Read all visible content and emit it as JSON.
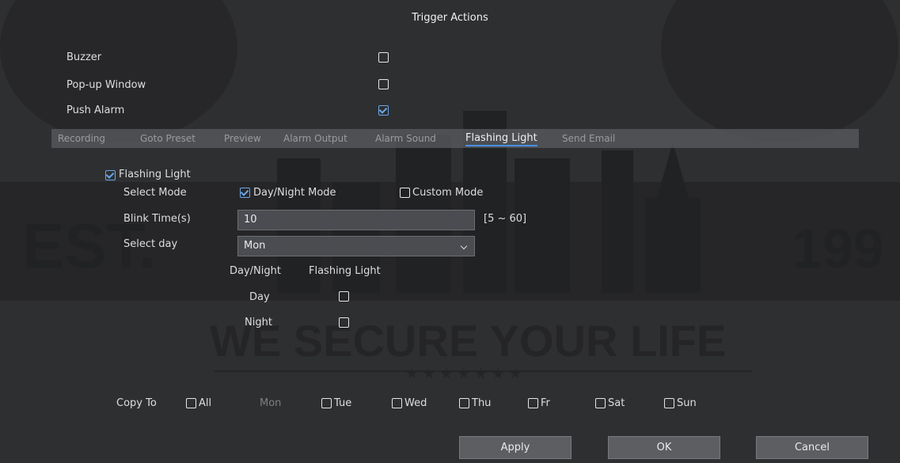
{
  "dialog": {
    "title": "Trigger Actions"
  },
  "options": [
    {
      "label": "Buzzer",
      "checked": false
    },
    {
      "label": "Pop-up Window",
      "checked": false
    },
    {
      "label": "Push Alarm",
      "checked": true
    }
  ],
  "tabs": [
    "Recording",
    "Goto Preset",
    "Preview",
    "Alarm Output",
    "Alarm Sound",
    "Flashing Light",
    "Send Email"
  ],
  "active_tab": "Flashing Light",
  "flashing": {
    "enable_label": "Flashing Light",
    "enable_checked": true,
    "select_mode_label": "Select Mode",
    "mode_daynight_label": "Day/Night Mode",
    "mode_daynight_checked": true,
    "mode_custom_label": "Custom Mode",
    "mode_custom_checked": false,
    "blink_label": "Blink Time(s)",
    "blink_value": "10",
    "blink_range": "[5 ~ 60]",
    "select_day_label": "Select day",
    "select_day_value": "Mon",
    "table_col1": "Day/Night",
    "table_col2": "Flashing Light",
    "rows": [
      {
        "label": "Day",
        "checked": false
      },
      {
        "label": "Night",
        "checked": false
      }
    ]
  },
  "copy": {
    "label": "Copy To",
    "all": "All",
    "current": "Mon",
    "days": [
      "Tue",
      "Wed",
      "Thu",
      "Fr",
      "Sat",
      "Sun"
    ]
  },
  "buttons": {
    "apply": "Apply",
    "ok": "OK",
    "cancel": "Cancel"
  },
  "background": {
    "left_text": "EST.",
    "right_text": "199",
    "slogan": "WE SECURE YOUR LIFE",
    "stars": "★ ★ ★ ★ ★ ★ ★"
  }
}
